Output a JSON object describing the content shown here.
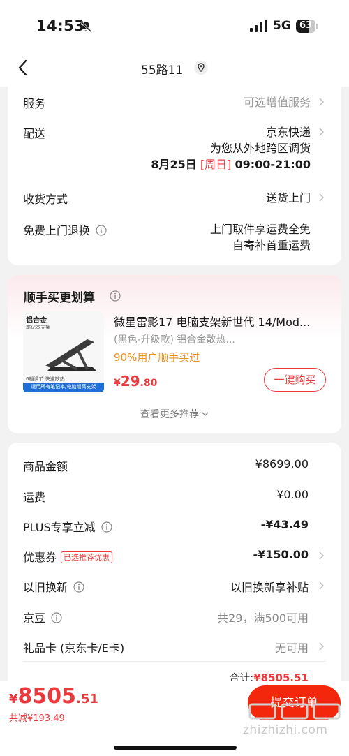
{
  "status_bar": {
    "time": "14:53",
    "network": "5G",
    "battery": "63",
    "battery_level": 0.63
  },
  "nav": {
    "title": "55路11",
    "back_icon": "chevron-left-icon",
    "location_icon": "location-pin-icon"
  },
  "service_card": {
    "service": {
      "label": "服务",
      "value": "可选增值服务"
    },
    "delivery": {
      "label": "配送",
      "carrier": "京东快递",
      "note": "为您从外地跨区调货",
      "date": "8月25日",
      "weekday": "[周日]",
      "time_window": "09:00-21:00"
    },
    "receive_method": {
      "label": "收货方式",
      "value": "送货上门"
    },
    "free_return": {
      "label": "免费上门退换",
      "value_line1": "上门取件享运费全免",
      "value_line2": "自寄补首重运费"
    }
  },
  "recommend_card": {
    "title": "顺手买更划算",
    "product": {
      "name": "微星雷影17 电脑支架新世代 14/Mod...",
      "spec": "(黑色-升级款) 铝合金散热...",
      "stat": "90%用户顺手买过",
      "price_symbol": "¥",
      "price_int": "29",
      "price_dec": ".80",
      "image_tag_1": "铝合金",
      "image_tag_2": "笔记本支架",
      "image_tag_3": "6档调节 快速散热",
      "image_banner": "适用所有笔记本/电脑增高支架"
    },
    "buy_button": "一键购买",
    "more_link": "查看更多推荐"
  },
  "price_card": {
    "goods_amount": {
      "label": "商品金额",
      "value": "¥8699.00"
    },
    "shipping": {
      "label": "运费",
      "value": "¥0.00"
    },
    "plus": {
      "label": "PLUS专享立减",
      "value": "-¥43.49"
    },
    "coupon": {
      "label": "优惠券",
      "tag": "已选推荐优惠",
      "value": "-¥150.00"
    },
    "trade_in": {
      "label": "以旧换新",
      "value": "以旧换新享补贴"
    },
    "jingdou": {
      "label": "京豆",
      "value": "共29，满500可用"
    },
    "gift_card": {
      "label": "礼品卡 (京东卡/E卡)",
      "value": "无可用"
    },
    "total_label": "合计:",
    "total_value": "¥8505.51"
  },
  "bottom_bar": {
    "price_symbol": "¥",
    "price_int": "8505",
    "price_dec": ".51",
    "saved": "共减¥193.49",
    "submit": "提交订单",
    "watermark": "zhizhizhi.com"
  },
  "colors": {
    "accent_red": "#e93b3d",
    "submit_red": "#f2270c",
    "orange": "#e8901c",
    "gray_text": "#999999"
  }
}
